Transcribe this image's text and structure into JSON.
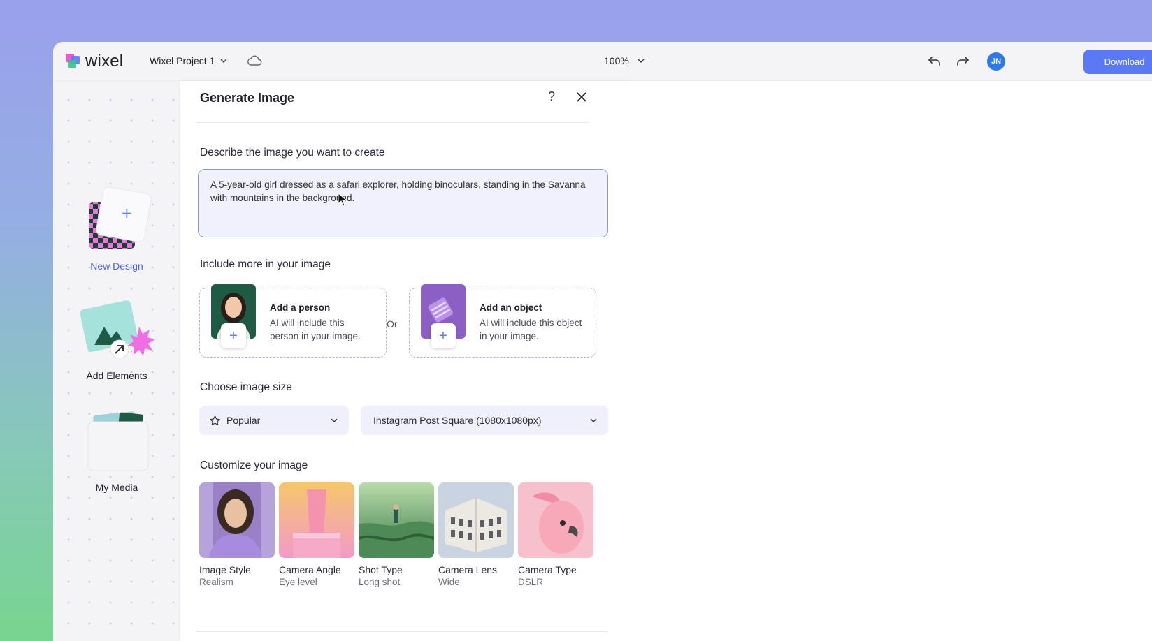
{
  "app": {
    "logo_text": "wixel",
    "project_name": "Wixel Project 1",
    "zoom": "100%",
    "user_initials": "JN",
    "download_label": "Download",
    "accent_color": "#5b79f5"
  },
  "sidebar": {
    "items": [
      {
        "label": "New Design",
        "icon": "new-design-icon",
        "active": true
      },
      {
        "label": "Add Elements",
        "icon": "add-elements-icon",
        "active": false
      },
      {
        "label": "My Media",
        "icon": "my-media-icon",
        "active": false
      }
    ]
  },
  "panel": {
    "title": "Generate Image",
    "help_symbol": "?",
    "prompt_label": "Describe the image you want to create",
    "prompt_value": "A 5-year-old girl dressed as a safari explorer, holding binoculars, standing in the Savanna with mountains in the background.",
    "include_label": "Include more in your image",
    "add_person": {
      "title": "Add a person",
      "description": "AI will include this person in your image."
    },
    "or_label": "Or",
    "add_object": {
      "title": "Add an object",
      "description": "AI will include this object in your image."
    },
    "size_label": "Choose image size",
    "size_category": "Popular",
    "size_value": "Instagram Post Square (1080x1080px)",
    "customize_label": "Customize your image",
    "options": [
      {
        "title": "Image Style",
        "value": "Realism"
      },
      {
        "title": "Camera Angle",
        "value": "Eye level"
      },
      {
        "title": "Shot Type",
        "value": "Long shot"
      },
      {
        "title": "Camera Lens",
        "value": "Wide"
      },
      {
        "title": "Camera Type",
        "value": "DSLR"
      }
    ]
  }
}
